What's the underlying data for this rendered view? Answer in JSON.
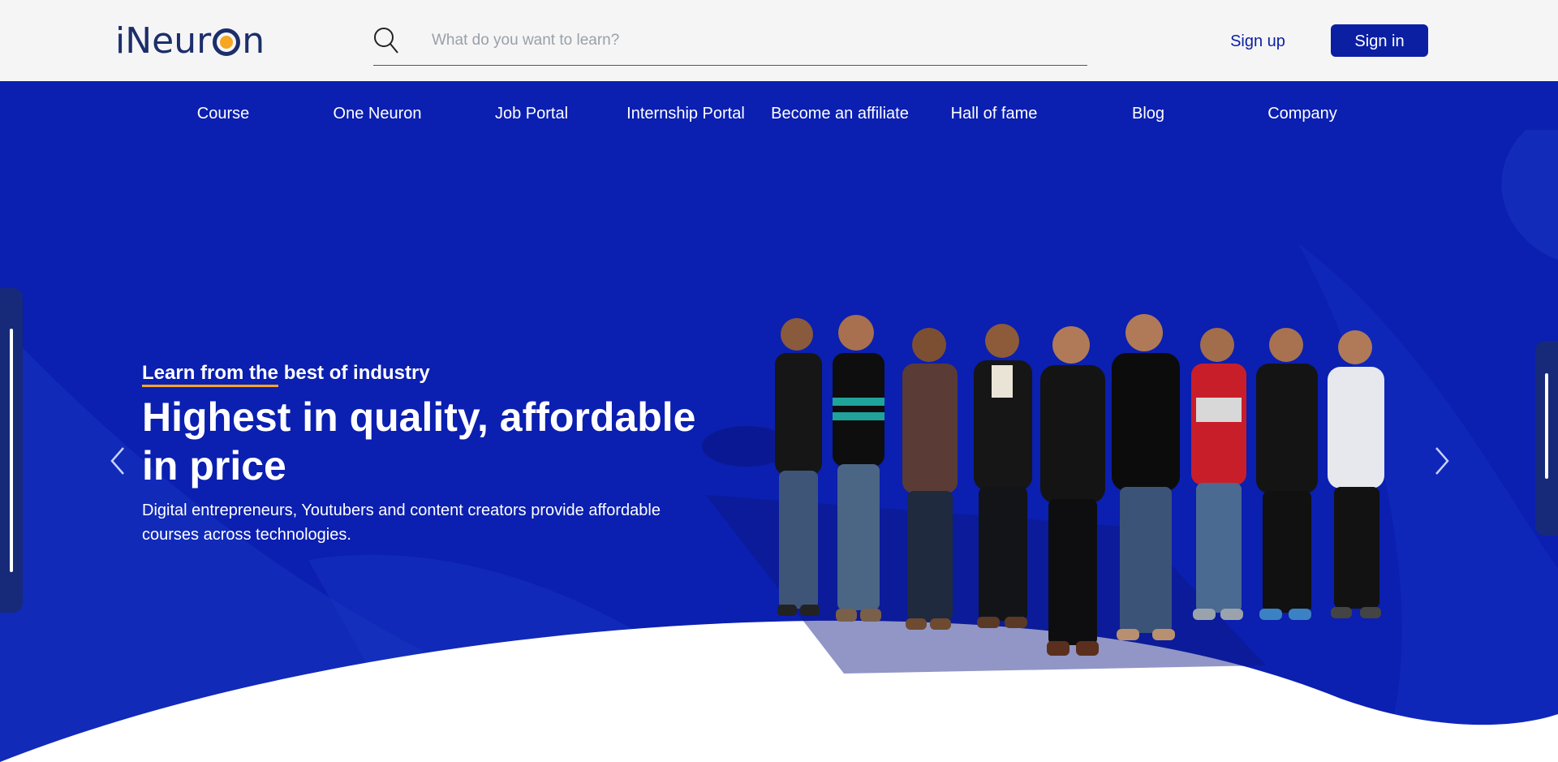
{
  "header": {
    "logo_text_left": "iNeur",
    "logo_text_right": "n",
    "search": {
      "placeholder": "What do you want to learn?"
    },
    "signup_label": "Sign up",
    "signin_label": "Sign in"
  },
  "nav": {
    "items": [
      {
        "label": "Course"
      },
      {
        "label": "One Neuron"
      },
      {
        "label": "Job Portal"
      },
      {
        "label": "Internship Portal"
      },
      {
        "label": "Become an affiliate"
      },
      {
        "label": "Hall of fame"
      },
      {
        "label": "Blog"
      },
      {
        "label": "Company"
      }
    ]
  },
  "hero": {
    "eyebrow_underlined": "Learn from the",
    "eyebrow_rest": " best of industry",
    "headline": "Highest in quality, affordable in price",
    "subtext": "Digital entrepreneurs, Youtubers and content creators provide affordable courses across technologies."
  },
  "colors": {
    "brand_blue": "#0b1fb0",
    "button_blue": "#0b1fa3",
    "accent_orange": "#f5a623",
    "header_bg": "#f5f5f5"
  },
  "icons": {
    "search": "search-icon",
    "prev": "chevron-left-icon",
    "next": "chevron-right-icon"
  }
}
